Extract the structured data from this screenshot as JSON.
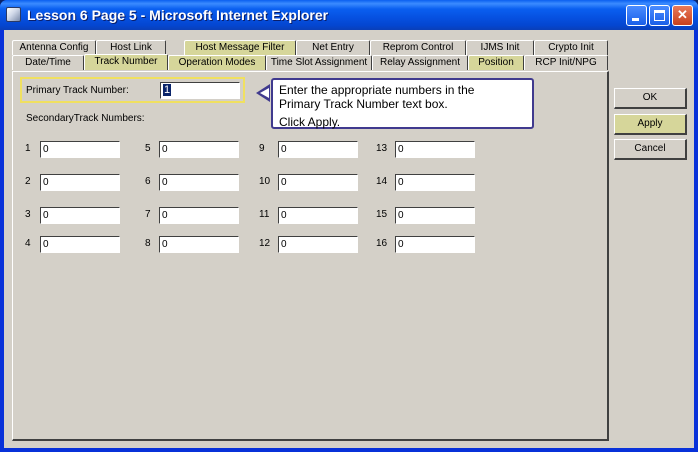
{
  "window": {
    "title": "Lesson 6 Page 5 - Microsoft Internet Explorer"
  },
  "tabs_row1": [
    "Antenna Config",
    "Host Link",
    "Host Message Filter",
    "Net Entry",
    "Reprom Control",
    "IJMS Init",
    "Crypto Init"
  ],
  "tabs_row2": [
    "Date/Time",
    "Track Number",
    "Operation Modes",
    "Time Slot Assignment",
    "Relay Assignment",
    "Position",
    "RCP Init/NPG"
  ],
  "form": {
    "primary_label": "Primary Track Number:",
    "primary_value": "1",
    "secondary_label": "SecondaryTrack Numbers:",
    "secondary": [
      {
        "n": "1",
        "v": "0"
      },
      {
        "n": "2",
        "v": "0"
      },
      {
        "n": "3",
        "v": "0"
      },
      {
        "n": "4",
        "v": "0"
      },
      {
        "n": "5",
        "v": "0"
      },
      {
        "n": "6",
        "v": "0"
      },
      {
        "n": "7",
        "v": "0"
      },
      {
        "n": "8",
        "v": "0"
      },
      {
        "n": "9",
        "v": "0"
      },
      {
        "n": "10",
        "v": "0"
      },
      {
        "n": "11",
        "v": "0"
      },
      {
        "n": "12",
        "v": "0"
      },
      {
        "n": "13",
        "v": "0"
      },
      {
        "n": "14",
        "v": "0"
      },
      {
        "n": "15",
        "v": "0"
      },
      {
        "n": "16",
        "v": "0"
      }
    ]
  },
  "callout": {
    "line1": "Enter the appropriate numbers in the",
    "line2": "Primary Track Number text box.",
    "line3": "Click Apply."
  },
  "buttons": {
    "ok": "OK",
    "apply": "Apply",
    "cancel": "Cancel"
  },
  "colors": {
    "highlight_tab": "#d6d69a",
    "callout_border": "#403a8e",
    "focus_box": "#f0e060"
  }
}
